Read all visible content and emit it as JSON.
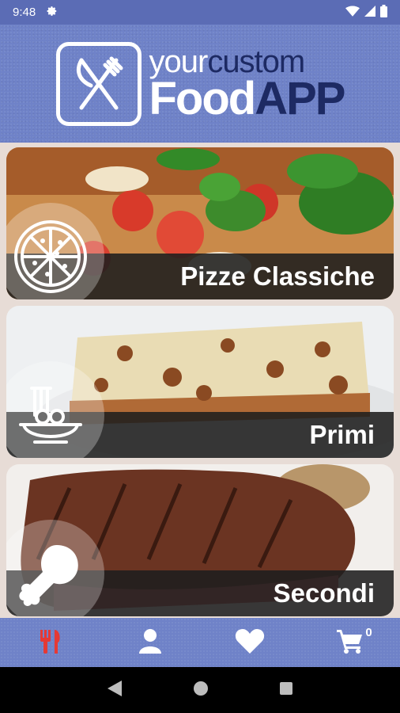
{
  "status_bar": {
    "time": "9:48"
  },
  "header": {
    "logo_line1_a": "your",
    "logo_line1_b": "custom",
    "logo_line2_a": "Food",
    "logo_line2_b": "APP"
  },
  "categories": [
    {
      "label": "Pizze Classiche",
      "icon": "pizza-icon"
    },
    {
      "label": "Primi",
      "icon": "pasta-icon"
    },
    {
      "label": "Secondi",
      "icon": "drumstick-icon"
    }
  ],
  "bottom_nav": {
    "items": [
      "menu-icon",
      "user-icon",
      "heart-icon",
      "cart-icon"
    ],
    "cart_count": "0",
    "active_color": "#e53935"
  },
  "colors": {
    "header_bg": "#6f82c8",
    "status_bg": "#5b6cb5",
    "logo_dark": "#1d2a63"
  }
}
